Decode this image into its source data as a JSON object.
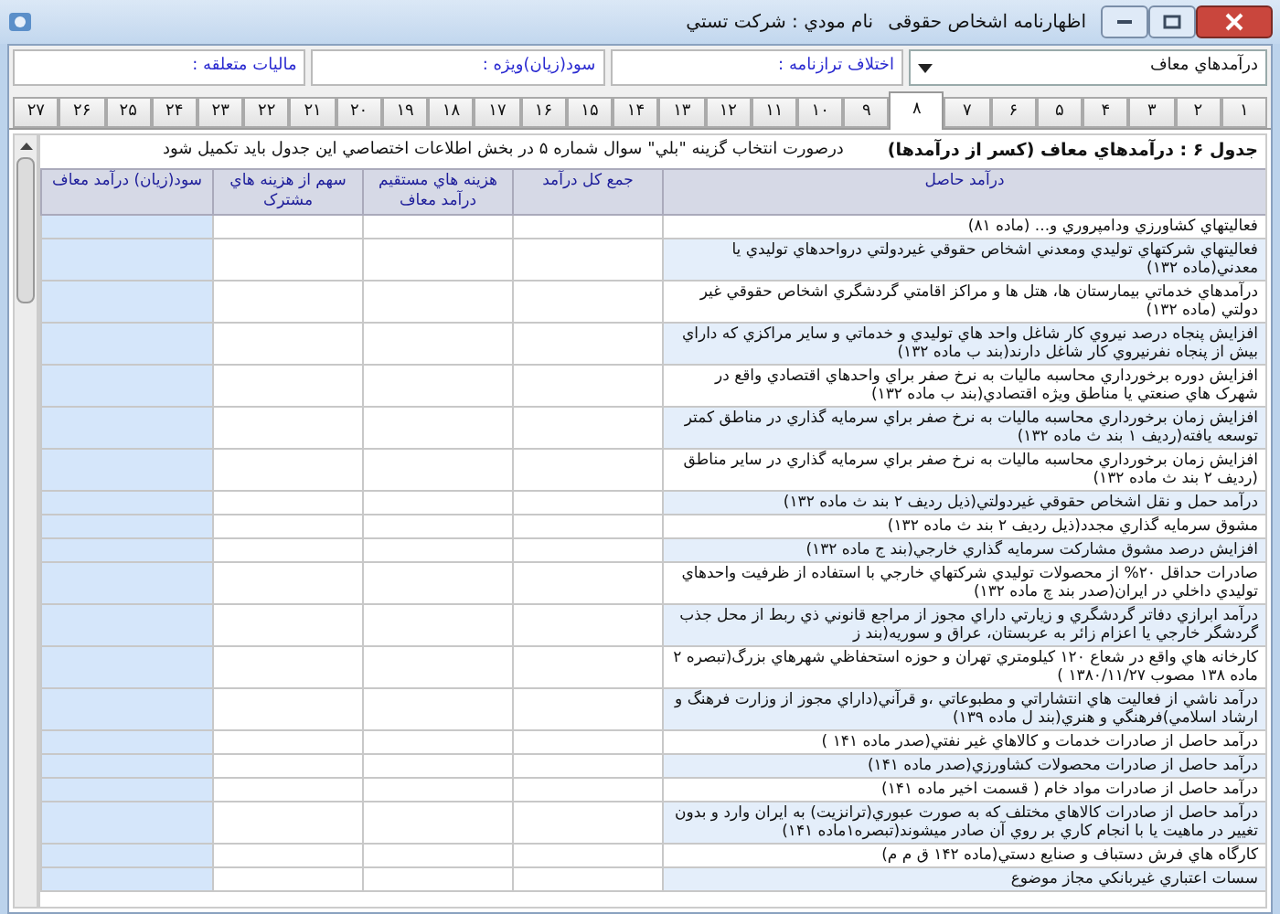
{
  "window": {
    "title": "اظهارنامه اشخاص حقوقی",
    "taxpayer": "نام مودي : شرکت تستي"
  },
  "header": {
    "dropdown": {
      "value": "درآمدهاي معاف"
    },
    "fields": [
      {
        "label": "اختلاف ترازنامه :"
      },
      {
        "label": "سود(زيان)ويژه :"
      },
      {
        "label": "ماليات متعلقه :"
      }
    ]
  },
  "tabs": [
    {
      "label": "۱",
      "selected": false
    },
    {
      "label": "۲",
      "selected": false
    },
    {
      "label": "۳",
      "selected": false
    },
    {
      "label": "۴",
      "selected": false
    },
    {
      "label": "۵",
      "selected": false
    },
    {
      "label": "۶",
      "selected": false
    },
    {
      "label": "۷",
      "selected": false
    },
    {
      "label": "۸",
      "selected": true
    },
    {
      "label": "۹",
      "selected": false
    },
    {
      "label": "۱۰",
      "selected": false
    },
    {
      "label": "۱۱",
      "selected": false
    },
    {
      "label": "۱۲",
      "selected": false
    },
    {
      "label": "۱۳",
      "selected": false
    },
    {
      "label": "۱۴",
      "selected": false
    },
    {
      "label": "۱۵",
      "selected": false
    },
    {
      "label": "۱۶",
      "selected": false
    },
    {
      "label": "۱۷",
      "selected": false
    },
    {
      "label": "۱۸",
      "selected": false
    },
    {
      "label": "۱۹",
      "selected": false
    },
    {
      "label": "۲۰",
      "selected": false
    },
    {
      "label": "۲۱",
      "selected": false
    },
    {
      "label": "۲۲",
      "selected": false
    },
    {
      "label": "۲۳",
      "selected": false
    },
    {
      "label": "۲۴",
      "selected": false
    },
    {
      "label": "۲۵",
      "selected": false
    },
    {
      "label": "۲۶",
      "selected": false
    },
    {
      "label": "۲۷",
      "selected": false
    }
  ],
  "table": {
    "title": "جدول ۶ : درآمدهاي معاف (کسر از درآمدها)",
    "note": "درصورت انتخاب گزينه \"بلي\" سوال شماره ۵ در بخش اطلاعات اختصاصي اين جدول بايد تکميل شود",
    "columns": [
      "درآمد حاصل",
      "جمع کل درآمد",
      "هزينه هاي مستقيم درآمد معاف",
      "سهم از هزينه هاي مشترک",
      "سود(زيان) درآمد معاف"
    ],
    "rows": [
      {
        "label": "فعاليتهاي کشاورزي ودامپروري و... (ماده ۸۱)"
      },
      {
        "label": "فعاليتهاي شرکتهاي توليدي ومعدني اشخاص حقوقي غيردولتي درواحدهاي توليدي يا معدني(ماده ۱۳۲)"
      },
      {
        "label": "درآمدهاي خدماتي بيمارستان ها، هتل ها و مراکز اقامتي گردشگري اشخاص حقوقي غير دولتي (ماده ۱۳۲)"
      },
      {
        "label": "افزايش پنجاه درصد نيروي کار شاغل واحد هاي توليدي و خدماتي و ساير مراکزي که داراي بيش از پنجاه نفرنيروي کار شاغل دارند(بند ب ماده ۱۳۲)"
      },
      {
        "label": "افزايش دوره برخورداري محاسبه ماليات به نرخ صفر براي واحدهاي اقتصادي واقع در شهرک هاي صنعتي يا مناطق ويژه اقتصادي(بند ب ماده ۱۳۲)"
      },
      {
        "label": "افزايش زمان برخورداري محاسبه ماليات به نرخ صفر براي سرمايه گذاري در مناطق کمتر توسعه يافته(رديف ۱ بند ث ماده ۱۳۲)"
      },
      {
        "label": "افزايش زمان برخورداري محاسبه ماليات به نرخ صفر براي سرمايه گذاري در ساير مناطق (رديف ۲ بند ث ماده ۱۳۲)"
      },
      {
        "label": "درآمد حمل و نقل اشخاص حقوقي غيردولتي(ذيل رديف ۲ بند ث ماده ۱۳۲)"
      },
      {
        "label": "مشوق سرمايه گذاري مجدد(ذيل رديف ۲ بند ث ماده ۱۳۲)"
      },
      {
        "label": "افزايش درصد مشوق مشارکت سرمايه گذاري خارجي(بند ج ماده ۱۳۲)"
      },
      {
        "label": "صادرات حداقل ۲۰% از محصولات توليدي شرکتهاي خارجي با استفاده از ظرفيت واحدهاي توليدي داخلي در ايران(صدر بند چ ماده ۱۳۲)"
      },
      {
        "label": "درآمد ابرازي دفاتر گردشگري و زيارتي داراي مجوز از مراجع قانوني ذي ربط از محل جذب گردشگر خارجي يا اعزام زائر به عربستان، عراق و سوريه(بند ز"
      },
      {
        "label": "کارخانه هاي واقع در شعاع ۱۲۰ کيلومتري تهران و حوزه استحفاظي شهرهاي بزرگ(تبصره ۲ ماده ۱۳۸ مصوب ۱۳۸۰/۱۱/۲۷ )"
      },
      {
        "label": "درآمد ناشي از فعاليت هاي انتشاراتي و مطبوعاتي ،و قرآني(داراي مجوز از وزارت فرهنگ و ارشاد اسلامي)فرهنگي و هنري(بند ل ماده ۱۳۹)"
      },
      {
        "label": "درآمد حاصل از صادرات خدمات و کالاهاي غير نفتي(صدر ماده ۱۴۱ )"
      },
      {
        "label": "درآمد حاصل از صادرات محصولات کشاورزي(صدر ماده ۱۴۱)"
      },
      {
        "label": "درآمد حاصل از صادرات مواد خام ( قسمت اخير ماده ۱۴۱)"
      },
      {
        "label": "درآمد حاصل از صادرات کالاهاي مختلف که به صورت عبوري(ترانزيت) به ايران وارد و بدون تغيير در ماهيت يا با انجام کاري بر روي آن صادر ميشوند(تبصره۱ماده ۱۴۱)"
      },
      {
        "label": "کارگاه هاي فرش دستباف و صنايع دستي(ماده ۱۴۲ ق م م)"
      },
      {
        "label": "سسات اعتباري غيربانکي مجاز موضوع"
      }
    ]
  }
}
